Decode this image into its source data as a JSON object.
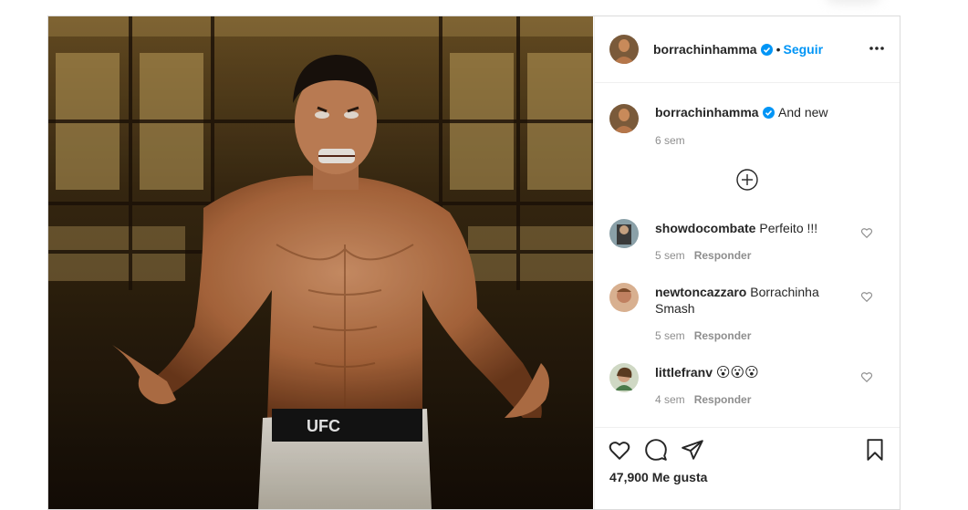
{
  "post": {
    "author": "borrachinhamma",
    "follow_label": "Seguir",
    "dot": "•",
    "caption": {
      "username": "borrachinhamma",
      "text": "And new",
      "time": "6 sem"
    },
    "load_more_icon": "plus-circle-icon",
    "comments": [
      {
        "username": "showdocombate",
        "text": "Perfeito !!!",
        "time": "5 sem",
        "reply": "Responder"
      },
      {
        "username": "newtoncazzaro",
        "text": "Borrachinha Smash",
        "time": "5 sem",
        "reply": "Responder"
      },
      {
        "username": "littlefranv",
        "text": "😮😮😮",
        "time": "4 sem",
        "reply": "Responder"
      }
    ],
    "likes": "47,900 Me gusta",
    "photo_label": "UFC"
  },
  "colors": {
    "accent": "#0095f6",
    "text": "#262626",
    "muted": "#8e8e8e",
    "border": "#dbdbdb"
  }
}
